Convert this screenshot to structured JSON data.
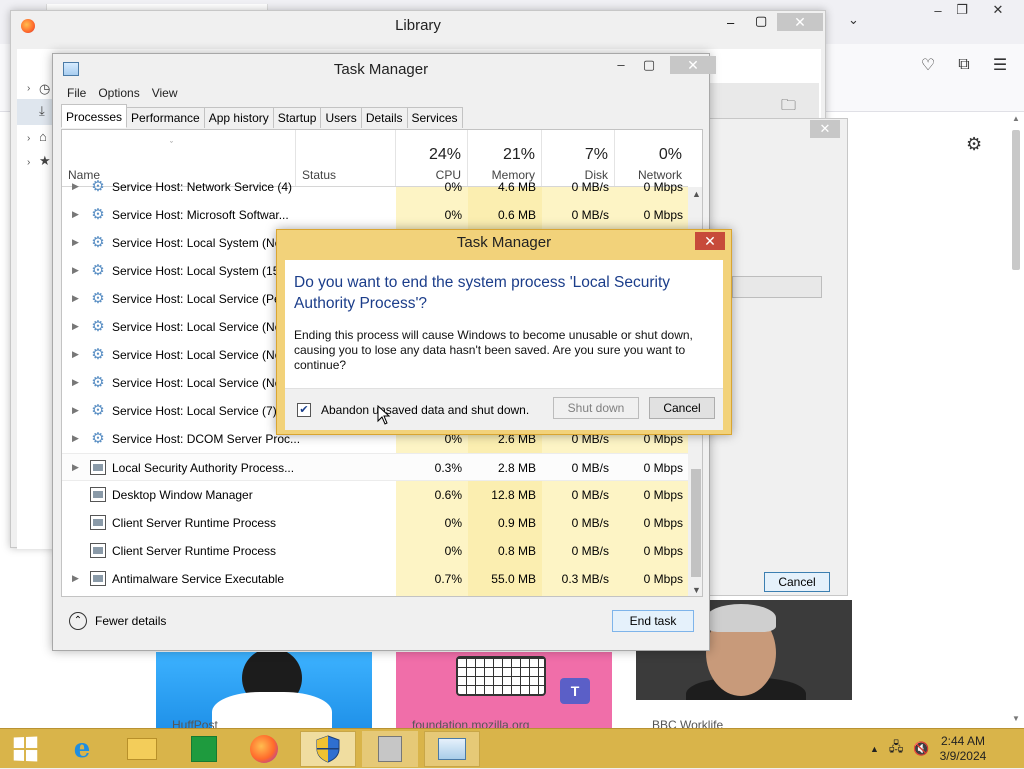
{
  "firefox": {
    "new_tab_title": "",
    "cards": [
      {
        "label": "HuffPost"
      },
      {
        "label": "foundation.mozilla.org"
      },
      {
        "label": "BBC Worklife"
      }
    ]
  },
  "library": {
    "title": "Library"
  },
  "background_dialog": {
    "cancel_label": "Cancel"
  },
  "task_manager": {
    "title": "Task Manager",
    "menu": [
      "File",
      "Options",
      "View"
    ],
    "tabs": [
      "Processes",
      "Performance",
      "App history",
      "Startup",
      "Users",
      "Details",
      "Services"
    ],
    "active_tab": "Processes",
    "columns": {
      "name": "Name",
      "status": "Status",
      "cpu": {
        "pct": "24%",
        "label": "CPU"
      },
      "memory": {
        "pct": "21%",
        "label": "Memory"
      },
      "disk": {
        "pct": "7%",
        "label": "Disk"
      },
      "network": {
        "pct": "0%",
        "label": "Network"
      }
    },
    "rows": [
      {
        "name": "Service Host: Network Service (4)",
        "cpu": "0%",
        "mem": "4.6 MB",
        "disk": "0 MB/s",
        "net": "0 Mbps",
        "icon": "gear-icon",
        "expandable": true
      },
      {
        "name": "Service Host: Microsoft Softwar...",
        "cpu": "0%",
        "mem": "0.6 MB",
        "disk": "0 MB/s",
        "net": "0 Mbps",
        "icon": "gear-icon",
        "expandable": true
      },
      {
        "name": "Service Host: Local System (Net",
        "cpu": "",
        "mem": "",
        "disk": "",
        "net": "",
        "icon": "gear-icon",
        "expandable": true
      },
      {
        "name": "Service Host: Local System (15)",
        "cpu": "",
        "mem": "",
        "disk": "",
        "net": "",
        "icon": "gear-icon",
        "expandable": true
      },
      {
        "name": "Service Host: Local Service (Pee",
        "cpu": "",
        "mem": "",
        "disk": "",
        "net": "",
        "icon": "gear-icon",
        "expandable": true
      },
      {
        "name": "Service Host: Local Service (No",
        "cpu": "",
        "mem": "",
        "disk": "",
        "net": "",
        "icon": "gear-icon",
        "expandable": true
      },
      {
        "name": "Service Host: Local Service (No",
        "cpu": "",
        "mem": "",
        "disk": "",
        "net": "",
        "icon": "gear-icon",
        "expandable": true
      },
      {
        "name": "Service Host: Local Service (Net",
        "cpu": "",
        "mem": "",
        "disk": "",
        "net": "",
        "icon": "gear-icon",
        "expandable": true
      },
      {
        "name": "Service Host: Local Service (7)",
        "cpu": "",
        "mem": "",
        "disk": "",
        "net": "",
        "icon": "gear-icon",
        "expandable": true
      },
      {
        "name": "Service Host: DCOM Server Proc...",
        "cpu": "0%",
        "mem": "2.6 MB",
        "disk": "0 MB/s",
        "net": "0 Mbps",
        "icon": "gear-icon",
        "expandable": true
      },
      {
        "name": "Local Security Authority Process...",
        "cpu": "0.3%",
        "mem": "2.8 MB",
        "disk": "0 MB/s",
        "net": "0 Mbps",
        "icon": "app-icon",
        "expandable": true,
        "selected": true
      },
      {
        "name": "Desktop Window Manager",
        "cpu": "0.6%",
        "mem": "12.8 MB",
        "disk": "0 MB/s",
        "net": "0 Mbps",
        "icon": "app-icon",
        "expandable": false
      },
      {
        "name": "Client Server Runtime Process",
        "cpu": "0%",
        "mem": "0.9 MB",
        "disk": "0 MB/s",
        "net": "0 Mbps",
        "icon": "app-icon",
        "expandable": false
      },
      {
        "name": "Client Server Runtime Process",
        "cpu": "0%",
        "mem": "0.8 MB",
        "disk": "0 MB/s",
        "net": "0 Mbps",
        "icon": "app-icon",
        "expandable": false
      },
      {
        "name": "Antimalware Service Executable",
        "cpu": "0.7%",
        "mem": "55.0 MB",
        "disk": "0.3 MB/s",
        "net": "0 Mbps",
        "icon": "app-icon",
        "expandable": true
      }
    ],
    "fewer_details": "Fewer details",
    "end_task": "End task"
  },
  "confirm_dialog": {
    "title": "Task Manager",
    "question": "Do you want to end the system process 'Local Security Authority Process'?",
    "message": "Ending this process will cause Windows to become unusable or shut down, causing you to lose any data hasn't been saved. Are you sure you want to continue?",
    "checkbox_label": "Abandon unsaved data and shut down.",
    "checkbox_checked": true,
    "shutdown_label": "Shut down",
    "cancel_label": "Cancel"
  },
  "taskbar": {
    "items": [
      {
        "name": "internet-explorer-icon"
      },
      {
        "name": "file-explorer-icon"
      },
      {
        "name": "store-icon"
      },
      {
        "name": "firefox-icon"
      },
      {
        "name": "security-shield-icon"
      },
      {
        "name": "control-panel-icon"
      },
      {
        "name": "task-manager-icon"
      }
    ],
    "clock": {
      "time": "2:44 AM",
      "date": "3/9/2024"
    }
  },
  "colors": {
    "taskbar": "#d9b44a",
    "dialog_frame": "#f2d27a",
    "question_text": "#1b3d8a",
    "heat": "#fdf4c5"
  }
}
